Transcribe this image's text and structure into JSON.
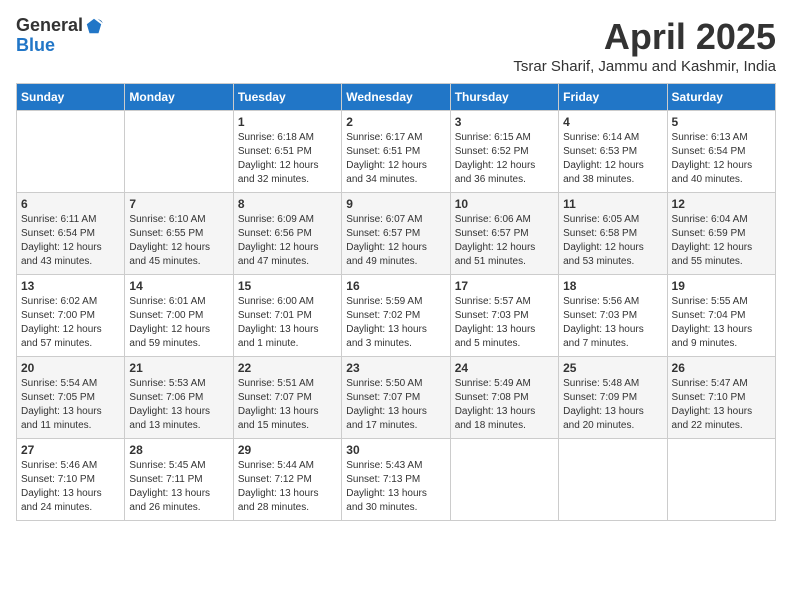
{
  "logo": {
    "general": "General",
    "blue": "Blue"
  },
  "title": "April 2025",
  "location": "Tsrar Sharif, Jammu and Kashmir, India",
  "days_header": [
    "Sunday",
    "Monday",
    "Tuesday",
    "Wednesday",
    "Thursday",
    "Friday",
    "Saturday"
  ],
  "weeks": [
    [
      {
        "day": "",
        "text": ""
      },
      {
        "day": "",
        "text": ""
      },
      {
        "day": "1",
        "text": "Sunrise: 6:18 AM\nSunset: 6:51 PM\nDaylight: 12 hours\nand 32 minutes."
      },
      {
        "day": "2",
        "text": "Sunrise: 6:17 AM\nSunset: 6:51 PM\nDaylight: 12 hours\nand 34 minutes."
      },
      {
        "day": "3",
        "text": "Sunrise: 6:15 AM\nSunset: 6:52 PM\nDaylight: 12 hours\nand 36 minutes."
      },
      {
        "day": "4",
        "text": "Sunrise: 6:14 AM\nSunset: 6:53 PM\nDaylight: 12 hours\nand 38 minutes."
      },
      {
        "day": "5",
        "text": "Sunrise: 6:13 AM\nSunset: 6:54 PM\nDaylight: 12 hours\nand 40 minutes."
      }
    ],
    [
      {
        "day": "6",
        "text": "Sunrise: 6:11 AM\nSunset: 6:54 PM\nDaylight: 12 hours\nand 43 minutes."
      },
      {
        "day": "7",
        "text": "Sunrise: 6:10 AM\nSunset: 6:55 PM\nDaylight: 12 hours\nand 45 minutes."
      },
      {
        "day": "8",
        "text": "Sunrise: 6:09 AM\nSunset: 6:56 PM\nDaylight: 12 hours\nand 47 minutes."
      },
      {
        "day": "9",
        "text": "Sunrise: 6:07 AM\nSunset: 6:57 PM\nDaylight: 12 hours\nand 49 minutes."
      },
      {
        "day": "10",
        "text": "Sunrise: 6:06 AM\nSunset: 6:57 PM\nDaylight: 12 hours\nand 51 minutes."
      },
      {
        "day": "11",
        "text": "Sunrise: 6:05 AM\nSunset: 6:58 PM\nDaylight: 12 hours\nand 53 minutes."
      },
      {
        "day": "12",
        "text": "Sunrise: 6:04 AM\nSunset: 6:59 PM\nDaylight: 12 hours\nand 55 minutes."
      }
    ],
    [
      {
        "day": "13",
        "text": "Sunrise: 6:02 AM\nSunset: 7:00 PM\nDaylight: 12 hours\nand 57 minutes."
      },
      {
        "day": "14",
        "text": "Sunrise: 6:01 AM\nSunset: 7:00 PM\nDaylight: 12 hours\nand 59 minutes."
      },
      {
        "day": "15",
        "text": "Sunrise: 6:00 AM\nSunset: 7:01 PM\nDaylight: 13 hours\nand 1 minute."
      },
      {
        "day": "16",
        "text": "Sunrise: 5:59 AM\nSunset: 7:02 PM\nDaylight: 13 hours\nand 3 minutes."
      },
      {
        "day": "17",
        "text": "Sunrise: 5:57 AM\nSunset: 7:03 PM\nDaylight: 13 hours\nand 5 minutes."
      },
      {
        "day": "18",
        "text": "Sunrise: 5:56 AM\nSunset: 7:03 PM\nDaylight: 13 hours\nand 7 minutes."
      },
      {
        "day": "19",
        "text": "Sunrise: 5:55 AM\nSunset: 7:04 PM\nDaylight: 13 hours\nand 9 minutes."
      }
    ],
    [
      {
        "day": "20",
        "text": "Sunrise: 5:54 AM\nSunset: 7:05 PM\nDaylight: 13 hours\nand 11 minutes."
      },
      {
        "day": "21",
        "text": "Sunrise: 5:53 AM\nSunset: 7:06 PM\nDaylight: 13 hours\nand 13 minutes."
      },
      {
        "day": "22",
        "text": "Sunrise: 5:51 AM\nSunset: 7:07 PM\nDaylight: 13 hours\nand 15 minutes."
      },
      {
        "day": "23",
        "text": "Sunrise: 5:50 AM\nSunset: 7:07 PM\nDaylight: 13 hours\nand 17 minutes."
      },
      {
        "day": "24",
        "text": "Sunrise: 5:49 AM\nSunset: 7:08 PM\nDaylight: 13 hours\nand 18 minutes."
      },
      {
        "day": "25",
        "text": "Sunrise: 5:48 AM\nSunset: 7:09 PM\nDaylight: 13 hours\nand 20 minutes."
      },
      {
        "day": "26",
        "text": "Sunrise: 5:47 AM\nSunset: 7:10 PM\nDaylight: 13 hours\nand 22 minutes."
      }
    ],
    [
      {
        "day": "27",
        "text": "Sunrise: 5:46 AM\nSunset: 7:10 PM\nDaylight: 13 hours\nand 24 minutes."
      },
      {
        "day": "28",
        "text": "Sunrise: 5:45 AM\nSunset: 7:11 PM\nDaylight: 13 hours\nand 26 minutes."
      },
      {
        "day": "29",
        "text": "Sunrise: 5:44 AM\nSunset: 7:12 PM\nDaylight: 13 hours\nand 28 minutes."
      },
      {
        "day": "30",
        "text": "Sunrise: 5:43 AM\nSunset: 7:13 PM\nDaylight: 13 hours\nand 30 minutes."
      },
      {
        "day": "",
        "text": ""
      },
      {
        "day": "",
        "text": ""
      },
      {
        "day": "",
        "text": ""
      }
    ]
  ]
}
